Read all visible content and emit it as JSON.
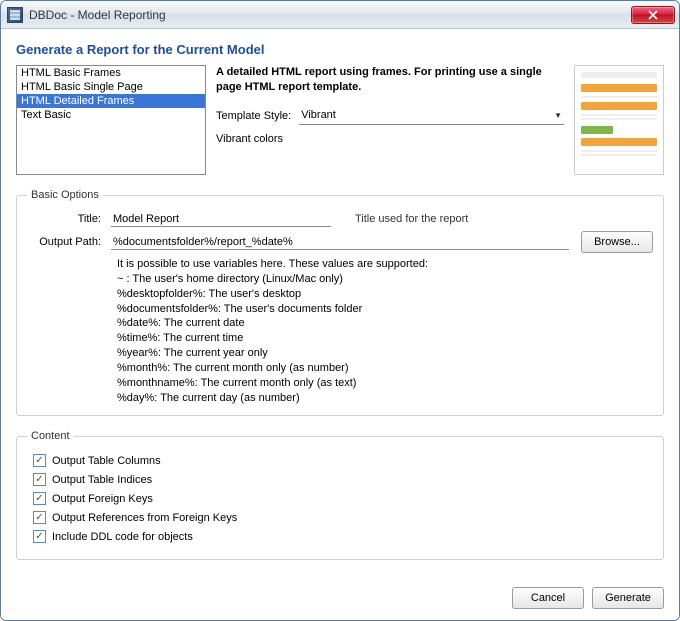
{
  "window": {
    "title": "DBDoc - Model Reporting"
  },
  "heading": "Generate a Report for the Current Model",
  "templates": {
    "items": [
      {
        "label": "HTML Basic Frames"
      },
      {
        "label": "HTML Basic Single Page"
      },
      {
        "label": "HTML Detailed Frames"
      },
      {
        "label": "Text Basic"
      }
    ],
    "selected_index": 2,
    "description": "A detailed HTML report using frames. For printing use a single page HTML report template.",
    "style_label": "Template Style:",
    "style_value": "Vibrant",
    "style_description": "Vibrant colors"
  },
  "basic_options": {
    "legend": "Basic Options",
    "title_label": "Title:",
    "title_value": "Model Report",
    "title_hint": "Title used for the report",
    "output_label": "Output Path:",
    "output_value": "%documentsfolder%/report_%date%",
    "browse_label": "Browse...",
    "variables_intro": "It is possible to use variables here. These values are supported:",
    "variables": [
      "~ : The user's home directory (Linux/Mac only)",
      "%desktopfolder%: The user's desktop",
      "%documentsfolder%: The user's documents folder",
      "%date%: The current date",
      "%time%: The current time",
      "%year%: The current year only",
      "%month%: The current month only (as number)",
      "%monthname%: The current month only (as text)",
      "%day%: The current day (as number)"
    ]
  },
  "content_group": {
    "legend": "Content",
    "options": [
      {
        "label": "Output Table Columns",
        "checked": true
      },
      {
        "label": "Output Table Indices",
        "checked": true
      },
      {
        "label": "Output Foreign Keys",
        "checked": true
      },
      {
        "label": "Output References from Foreign Keys",
        "checked": true
      },
      {
        "label": "Include DDL code for objects",
        "checked": true
      }
    ]
  },
  "footer": {
    "cancel": "Cancel",
    "generate": "Generate"
  }
}
